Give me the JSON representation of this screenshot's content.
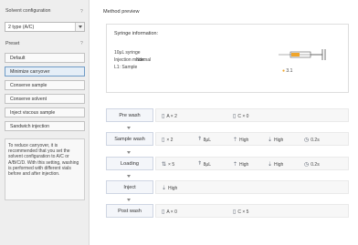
{
  "left_panel": {
    "solvent_label": "Solvent configuration",
    "solvent_help": "?",
    "solvent_value": "2 type (A/C)",
    "preset_label": "Preset",
    "preset_help": "?",
    "presets": [
      {
        "label": "Default"
      },
      {
        "label": "Minimize carryover"
      },
      {
        "label": "Conserve sample"
      },
      {
        "label": "Conserve solvent"
      },
      {
        "label": "Inject viscous sample"
      },
      {
        "label": "Sandwich injection"
      }
    ],
    "note": "To reduce carryover, it is recommended that you set the solvent configuration to A/C or A/B/C/D. With this setting, washing is performed with different vials before and after injection."
  },
  "right_panel": {
    "title": "Method preview",
    "syringe": {
      "title": "Syringe information:",
      "row1": "10μL syringe",
      "row2_label": "Injection mode:",
      "row2_value": "Normal",
      "row3": "L1: Sample",
      "volume_label": "3.1"
    },
    "steps": [
      {
        "label": "Pre wash",
        "items": [
          {
            "icon": "vial-icon",
            "text": "A × 2"
          },
          {
            "icon": "vial-icon",
            "text": "C × 0"
          }
        ]
      },
      {
        "label": "Sample wash",
        "items": [
          {
            "icon": "vial-icon",
            "text": "× 2"
          },
          {
            "icon": "syringe-icon",
            "text": "8μL"
          },
          {
            "icon": "speed-up-icon",
            "text": "High"
          },
          {
            "icon": "speed-down-icon",
            "text": "High"
          },
          {
            "icon": "timer-icon",
            "text": "0.2s"
          }
        ]
      },
      {
        "label": "Loading",
        "items": [
          {
            "icon": "cycle-icon",
            "text": "× 5"
          },
          {
            "icon": "syringe-icon",
            "text": "8μL"
          },
          {
            "icon": "speed-up-icon",
            "text": "High"
          },
          {
            "icon": "speed-down-icon",
            "text": "High"
          },
          {
            "icon": "timer-icon",
            "text": "0.2s"
          }
        ]
      },
      {
        "label": "Inject",
        "items": [
          {
            "icon": "speed-down-icon",
            "text": "High"
          }
        ]
      },
      {
        "label": "Post wash",
        "items": [
          {
            "icon": "vial-icon",
            "text": "A × 0"
          },
          {
            "icon": "vial-icon",
            "text": "C × 5"
          }
        ]
      }
    ]
  },
  "colors": {
    "accent": "#f0a52a",
    "panel_bg": "#eeeeee",
    "step_bg": "#f4f6fa"
  }
}
